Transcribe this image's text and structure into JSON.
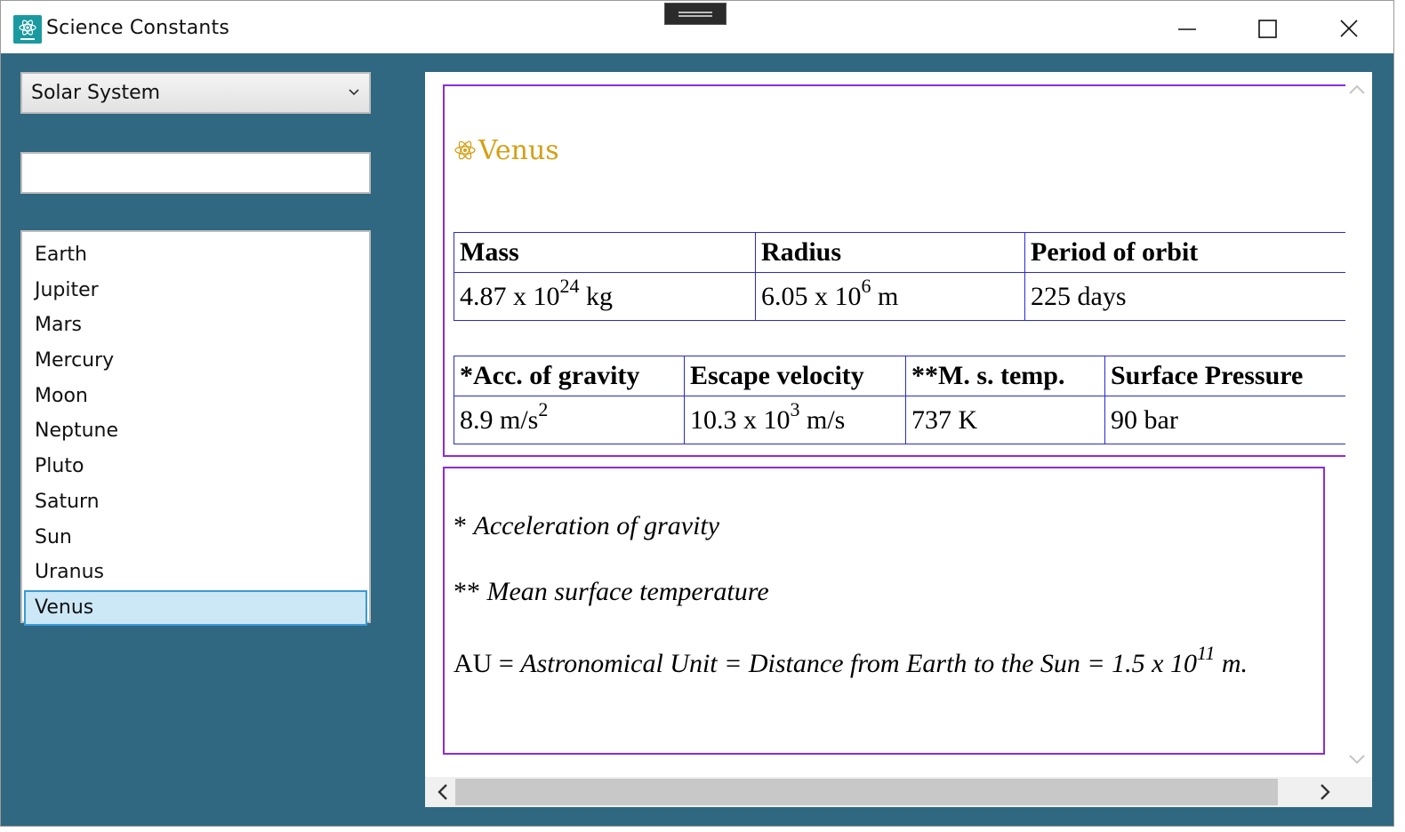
{
  "window": {
    "title": "Science Constants",
    "icon": "science-app-icon"
  },
  "sidebar": {
    "category": "Solar System",
    "search": {
      "value": "",
      "placeholder": ""
    },
    "items": [
      "Earth",
      "Jupiter",
      "Mars",
      "Mercury",
      "Moon",
      "Neptune",
      "Pluto",
      "Saturn",
      "Sun",
      "Uranus",
      "Venus"
    ],
    "selected": "Venus"
  },
  "content": {
    "heading": "Venus",
    "table1": {
      "headers": [
        "Mass",
        "Radius",
        "Period of orbit"
      ],
      "mass": {
        "base": "4.87 x 10",
        "exp": "24",
        "unit": " kg"
      },
      "radius": {
        "base": "6.05 x 10",
        "exp": "6",
        "unit": " m"
      },
      "period": "225 days"
    },
    "table2": {
      "headers": [
        "*Acc. of gravity",
        "Escape velocity",
        "**M. s. temp.",
        "Surface Pressure"
      ],
      "gravity": {
        "base": "8.9 m/s",
        "exp": "2"
      },
      "escape": {
        "base": "10.3 x 10",
        "exp": "3",
        "unit": " m/s"
      },
      "temp": "737 K",
      "pressure": "90 bar"
    },
    "notes": {
      "n1_prefix": "* ",
      "n1_text": "Acceleration of gravity",
      "n2_prefix": "** ",
      "n2_text": "Mean surface temperature",
      "n3_prefix": "AU = ",
      "n3_text": "Astronomical Unit = Distance from Earth to the Sun = 1.5 x 10",
      "n3_exp": "11",
      "n3_suffix": " m."
    }
  },
  "colors": {
    "background": "#306881",
    "heading": "#d4a017",
    "box_border": "#8a2be2",
    "table_border": "#2a2ad0",
    "selection": "#cce8f7"
  }
}
